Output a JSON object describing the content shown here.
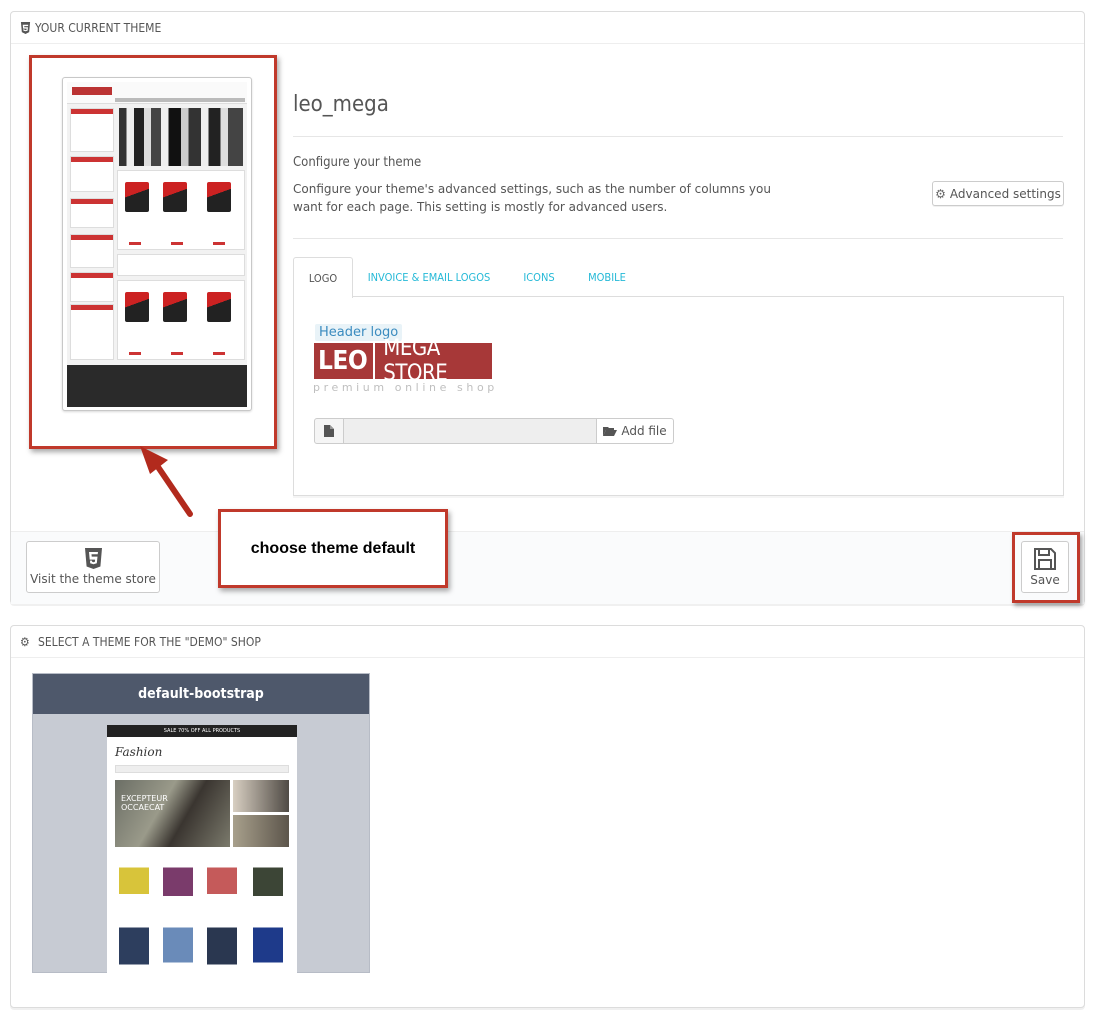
{
  "current_theme": {
    "heading": "YOUR CURRENT THEME",
    "name": "leo_mega",
    "configure_title": "Configure your theme",
    "configure_desc": "Configure your theme's advanced settings, such as the number of columns you want for each page. This setting is mostly for advanced users.",
    "advanced_button": "Advanced settings",
    "tabs": [
      {
        "label": "LOGO",
        "active": true
      },
      {
        "label": "INVOICE & EMAIL LOGOS",
        "active": false
      },
      {
        "label": "ICONS",
        "active": false
      },
      {
        "label": "MOBILE",
        "active": false
      }
    ],
    "logo_label": "Header logo",
    "logo_text_left": "LEO",
    "logo_text_right": "MEGA STORE",
    "logo_tagline": "premium online shop",
    "file_input_value": "",
    "add_file_button": "Add file",
    "store_button": "Visit the theme store",
    "save_button": "Save",
    "annotation": "choose theme default"
  },
  "select_theme": {
    "heading": "SELECT A THEME FOR THE \"DEMO\" SHOP",
    "theme_name": "default-bootstrap",
    "preview_top_text": "SALE 70% OFF ALL PRODUCTS",
    "preview_logo": "Fashion",
    "preview_banner_text": "EXCEPTEUR OCCAECAT"
  },
  "colors": {
    "accent": "#25b9d7",
    "annotation_red": "#c0392b",
    "theme_header": "#4e586b",
    "logo_red": "#a73838"
  }
}
